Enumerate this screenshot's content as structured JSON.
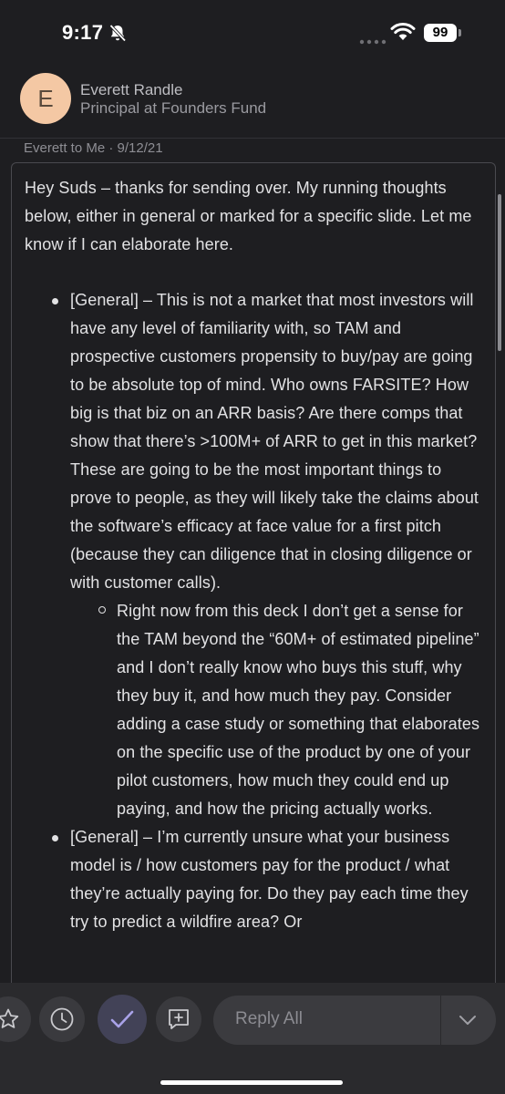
{
  "status_bar": {
    "time": "9:17",
    "battery": "99"
  },
  "sender": {
    "initial": "E",
    "name": "Everett Randle",
    "title": "Principal at Founders Fund"
  },
  "meta": "Everett to Me · 9/12/21",
  "message": {
    "intro": "Hey Suds – thanks for sending over. My running thoughts below, either in general or marked for a specific slide. Let me know if I can elaborate here.",
    "bullets": [
      {
        "text": "[General] – This is not a market that most investors will have any level of familiarity with, so TAM and prospective customers propensity to buy/pay are going to be absolute top of mind. Who owns FARSITE? How big is that biz on an ARR basis? Are there comps that show that there’s >100M+ of ARR to get in this market? These are going to be the most important things to prove to people, as they will likely take the claims about the software’s efficacy at face value for a first pitch (because they can diligence that in closing diligence or with customer calls).",
        "sub": "Right now from this deck I don’t get a sense for the TAM beyond the “60M+ of estimated pipeline” and I don’t really know who buys this stuff, why they buy it, and how much they pay. Consider adding a case study or something that elaborates on the specific use of the product by one of your pilot customers, how much they could end up paying, and how the pricing actually works."
      },
      {
        "text": "[General] – I’m currently unsure what your business model is / how customers pay for the product / what they’re actually paying for. Do they pay each time they try to predict a wildfire area? Or"
      }
    ]
  },
  "toolbar": {
    "reply_all_label": "Reply All"
  },
  "colors": {
    "background": "#1e1e21",
    "avatar": "#f4c8a4",
    "toolbar": "#2a2a2d",
    "check_accent": "#a9a2e8"
  },
  "icons": [
    "bell-slash-icon",
    "wifi-icon",
    "star-icon",
    "clock-icon",
    "check-icon",
    "add-note-icon",
    "chevron-down-icon"
  ]
}
